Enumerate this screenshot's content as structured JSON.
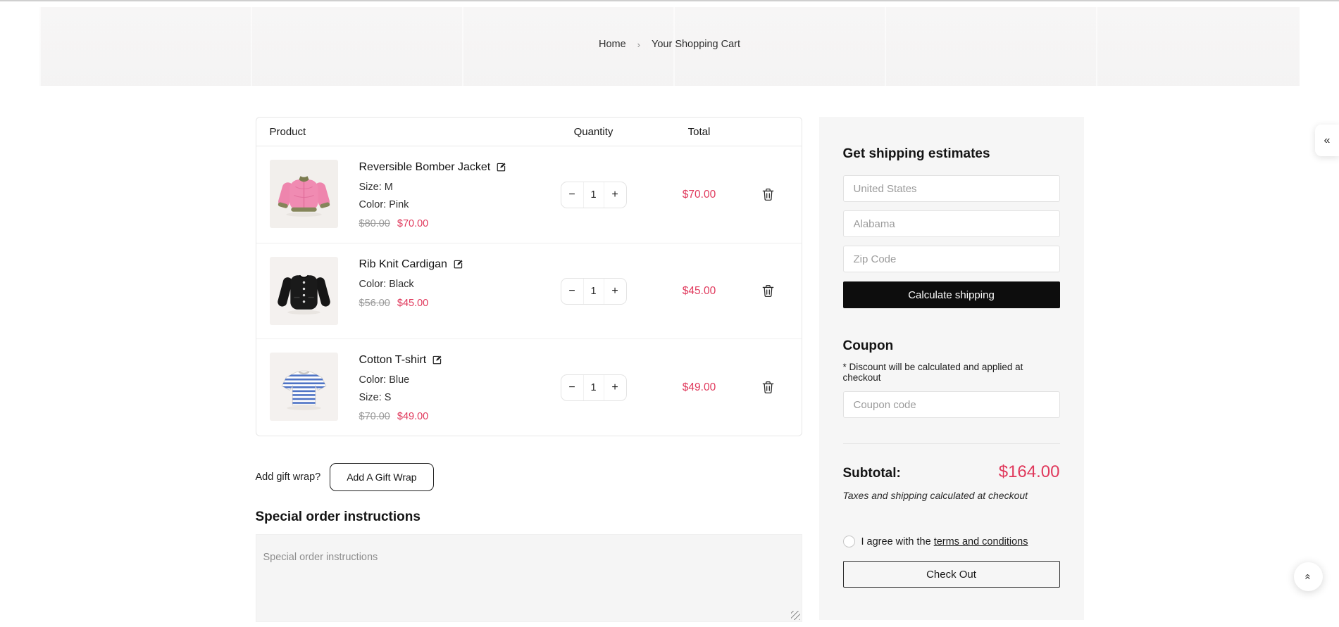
{
  "breadcrumb": {
    "home": "Home",
    "separator": "›",
    "current": "Your Shopping Cart"
  },
  "cart": {
    "headers": {
      "product": "Product",
      "quantity": "Quantity",
      "total": "Total"
    },
    "stepper": {
      "decrease": "−",
      "increase": "+"
    },
    "items": [
      {
        "name": "Reversible Bomber Jacket",
        "image": "pink-bomber-jacket-thumbnail",
        "attributes": [
          "Size: M",
          "Color: Pink"
        ],
        "old_price": "$80.00",
        "price": "$70.00",
        "quantity": "1",
        "total": "$70.00"
      },
      {
        "name": "Rib Knit Cardigan",
        "image": "black-cardigan-thumbnail",
        "attributes": [
          "Color: Black"
        ],
        "old_price": "$56.00",
        "price": "$45.00",
        "quantity": "1",
        "total": "$45.00"
      },
      {
        "name": "Cotton T-shirt",
        "image": "blue-striped-tshirt-thumbnail",
        "attributes": [
          "Color: Blue",
          "Size: S"
        ],
        "old_price": "$70.00",
        "price": "$49.00",
        "quantity": "1",
        "total": "$49.00"
      }
    ]
  },
  "gift_wrap": {
    "label": "Add gift wrap?",
    "button": "Add A Gift Wrap"
  },
  "special_instructions": {
    "heading": "Special order instructions",
    "placeholder": "Special order instructions"
  },
  "shipping": {
    "heading": "Get shipping estimates",
    "country_placeholder": "United States",
    "state_placeholder": "Alabama",
    "zip_placeholder": "Zip Code",
    "button": "Calculate shipping"
  },
  "coupon": {
    "heading": "Coupon",
    "note": "* Discount will be calculated and applied at checkout",
    "placeholder": "Coupon code"
  },
  "summary": {
    "subtotal_label": "Subtotal:",
    "subtotal_value": "$164.00",
    "taxes_note": "Taxes and shipping calculated at checkout",
    "agree_text": "I agree with the",
    "terms_link": "terms and conditions",
    "checkout_button": "Check Out"
  },
  "floating": {
    "collapse_icon": "«",
    "scroll_top_icon": "«"
  },
  "colors": {
    "accent_red": "#e0395c",
    "button_black": "#0d0d0d",
    "sidebar_bg": "#f6f6f6"
  }
}
